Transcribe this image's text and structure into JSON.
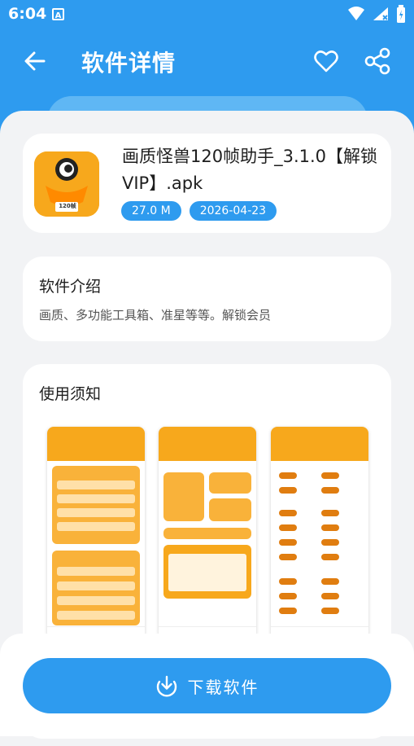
{
  "status_bar": {
    "time": "6:04",
    "notification_icon_letter": "A",
    "icons": [
      "wifi-icon",
      "signal-icon",
      "battery-icon"
    ]
  },
  "app_bar": {
    "title": "软件详情",
    "icons": [
      "back-arrow-icon",
      "heart-icon",
      "share-icon"
    ]
  },
  "app": {
    "name": "画质怪兽120帧助手_3.1.0【解锁VIP】.apk",
    "size": "27.0 M",
    "date": "2026-04-23",
    "icon_text": "120帧"
  },
  "intro": {
    "title": "软件介绍",
    "text": "画质、多功能工具箱、准星等等。解锁会员"
  },
  "notice": {
    "title": "使用须知"
  },
  "download": {
    "label": "下载软件"
  },
  "colors": {
    "primary": "#2e9bef",
    "background": "#f2f3f5",
    "card": "#ffffff",
    "app_icon": "#f7a81c"
  }
}
